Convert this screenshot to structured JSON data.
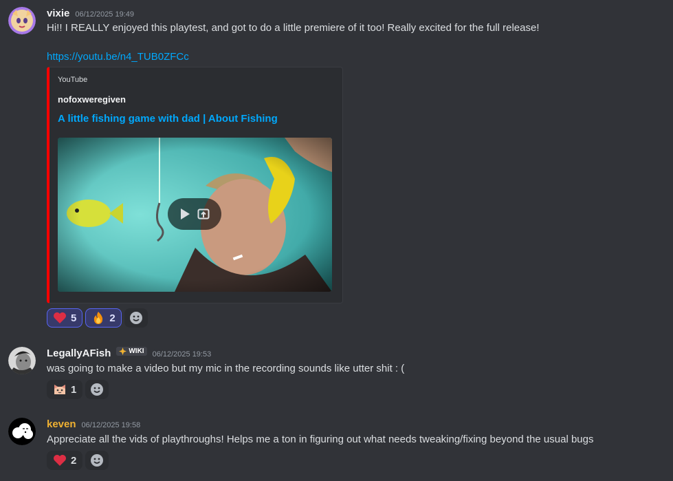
{
  "messages": [
    {
      "username": "vixie",
      "username_color": "#f2f3f5",
      "timestamp": "06/12/2025 19:49",
      "text": "Hi!! I REALLY enjoyed this playtest, and got to do a little premiere of it too! Really excited for the full release!",
      "link": "https://youtu.be/n4_TUB0ZFCc",
      "embed": {
        "provider": "YouTube",
        "author": "nofoxweregiven",
        "title": "A little fishing game with dad | About Fishing",
        "accent_color": "#ff0000"
      },
      "reactions": [
        {
          "emoji": "heart-emoji",
          "count": "5"
        },
        {
          "emoji": "fire-emoji",
          "count": "2"
        }
      ]
    },
    {
      "username": "LegallyAFish",
      "username_color": "#f2f3f5",
      "badge": "WIKI",
      "timestamp": "06/12/2025 19:53",
      "text": "was going to make a video but my mic in the recording sounds like utter shit : (",
      "reactions": [
        {
          "emoji": "cat-face-emoji",
          "count": "1"
        }
      ]
    },
    {
      "username": "keven",
      "username_color": "#f0b232",
      "timestamp": "06/12/2025 19:58",
      "text": "Appreciate all the vids of playthroughs! Helps me a ton in figuring out what needs tweaking/fixing beyond the usual bugs",
      "reactions": [
        {
          "emoji": "heart-emoji",
          "count": "2"
        }
      ]
    }
  ]
}
